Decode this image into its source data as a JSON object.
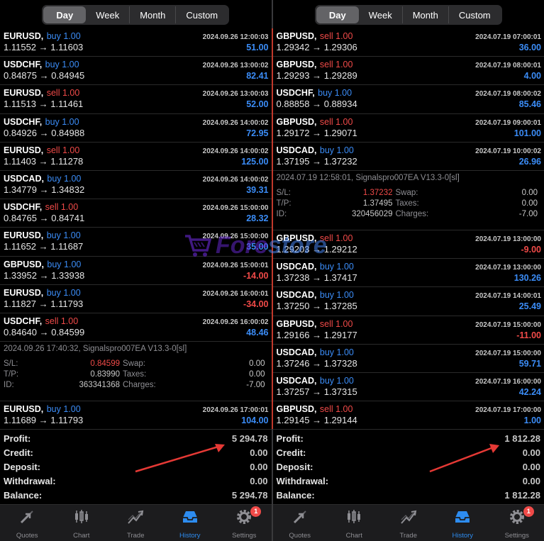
{
  "periods": [
    "Day",
    "Week",
    "Month",
    "Custom"
  ],
  "active_period": "Day",
  "left": {
    "trades": [
      {
        "symbol": "EURUSD,",
        "side": "buy 1.00",
        "dir": "buy",
        "time": "2024.09.26 12:00:03",
        "prices": "1.11552 → 1.11603",
        "profit": "51.00",
        "sign": "pos"
      },
      {
        "symbol": "USDCHF,",
        "side": "buy 1.00",
        "dir": "buy",
        "time": "2024.09.26 13:00:02",
        "prices": "0.84875 → 0.84945",
        "profit": "82.41",
        "sign": "pos"
      },
      {
        "symbol": "EURUSD,",
        "side": "sell 1.00",
        "dir": "sell",
        "time": "2024.09.26 13:00:03",
        "prices": "1.11513 → 1.11461",
        "profit": "52.00",
        "sign": "pos"
      },
      {
        "symbol": "USDCHF,",
        "side": "buy 1.00",
        "dir": "buy",
        "time": "2024.09.26 14:00:02",
        "prices": "0.84926 → 0.84988",
        "profit": "72.95",
        "sign": "pos"
      },
      {
        "symbol": "EURUSD,",
        "side": "sell 1.00",
        "dir": "sell",
        "time": "2024.09.26 14:00:02",
        "prices": "1.11403 → 1.11278",
        "profit": "125.00",
        "sign": "pos"
      },
      {
        "symbol": "USDCAD,",
        "side": "buy 1.00",
        "dir": "buy",
        "time": "2024.09.26 14:00:02",
        "prices": "1.34779 → 1.34832",
        "profit": "39.31",
        "sign": "pos"
      },
      {
        "symbol": "USDCHF,",
        "side": "sell 1.00",
        "dir": "sell",
        "time": "2024.09.26 15:00:00",
        "prices": "0.84765 → 0.84741",
        "profit": "28.32",
        "sign": "pos"
      },
      {
        "symbol": "EURUSD,",
        "side": "buy 1.00",
        "dir": "buy",
        "time": "2024.09.26 15:00:00",
        "prices": "1.11652 → 1.11687",
        "profit": "35.00",
        "sign": "pos"
      },
      {
        "symbol": "GBPUSD,",
        "side": "buy 1.00",
        "dir": "buy",
        "time": "2024.09.26 15:00:01",
        "prices": "1.33952 → 1.33938",
        "profit": "-14.00",
        "sign": "neg"
      },
      {
        "symbol": "EURUSD,",
        "side": "buy 1.00",
        "dir": "buy",
        "time": "2024.09.26 16:00:01",
        "prices": "1.11827 → 1.11793",
        "profit": "-34.00",
        "sign": "neg"
      },
      {
        "symbol": "USDCHF,",
        "side": "sell 1.00",
        "dir": "sell",
        "time": "2024.09.26 16:00:02",
        "prices": "0.84640 → 0.84599",
        "profit": "48.46",
        "sign": "pos"
      }
    ],
    "detail": {
      "header": "2024.09.26 17:40:32, Signalspro007EA V13.3-0[sl]",
      "sl_label": "S/L:",
      "sl": "0.84599",
      "swap_label": "Swap:",
      "swap": "0.00",
      "tp_label": "T/P:",
      "tp": "0.83990",
      "taxes_label": "Taxes:",
      "taxes": "0.00",
      "id_label": "ID:",
      "id": "363341368",
      "charges_label": "Charges:",
      "charges": "-7.00"
    },
    "last_trade": {
      "symbol": "EURUSD,",
      "side": "buy 1.00",
      "dir": "buy",
      "time": "2024.09.26 17:00:01",
      "prices": "1.11689 → 1.11793",
      "profit": "104.00",
      "sign": "pos"
    },
    "summary": [
      {
        "label": "Profit:",
        "value": "5 294.78"
      },
      {
        "label": "Credit:",
        "value": "0.00"
      },
      {
        "label": "Deposit:",
        "value": "0.00"
      },
      {
        "label": "Withdrawal:",
        "value": "0.00"
      },
      {
        "label": "Balance:",
        "value": "5 294.78"
      }
    ]
  },
  "right": {
    "trades": [
      {
        "symbol": "GBPUSD,",
        "side": "sell 1.00",
        "dir": "sell",
        "time": "2024.07.19 07:00:01",
        "prices": "1.29342 → 1.29306",
        "profit": "36.00",
        "sign": "pos"
      },
      {
        "symbol": "GBPUSD,",
        "side": "sell 1.00",
        "dir": "sell",
        "time": "2024.07.19 08:00:01",
        "prices": "1.29293 → 1.29289",
        "profit": "4.00",
        "sign": "pos"
      },
      {
        "symbol": "USDCHF,",
        "side": "buy 1.00",
        "dir": "buy",
        "time": "2024.07.19 08:00:02",
        "prices": "0.88858 → 0.88934",
        "profit": "85.46",
        "sign": "pos"
      },
      {
        "symbol": "GBPUSD,",
        "side": "sell 1.00",
        "dir": "sell",
        "time": "2024.07.19 09:00:01",
        "prices": "1.29172 → 1.29071",
        "profit": "101.00",
        "sign": "pos"
      },
      {
        "symbol": "USDCAD,",
        "side": "buy 1.00",
        "dir": "buy",
        "time": "2024.07.19 10:00:02",
        "prices": "1.37195 → 1.37232",
        "profit": "26.96",
        "sign": "pos"
      }
    ],
    "detail": {
      "header": "2024.07.19 12:58:01, Signalspro007EA V13.3-0[sl]",
      "sl_label": "S/L:",
      "sl": "1.37232",
      "swap_label": "Swap:",
      "swap": "0.00",
      "tp_label": "T/P:",
      "tp": "1.37495",
      "taxes_label": "Taxes:",
      "taxes": "0.00",
      "id_label": "ID:",
      "id": "320456029",
      "charges_label": "Charges:",
      "charges": "-7.00"
    },
    "trades2": [
      {
        "symbol": "GBPUSD,",
        "side": "sell 1.00",
        "dir": "sell",
        "time": "2024.07.19 13:00:00",
        "prices": "1.29203 → 1.29212",
        "profit": "-9.00",
        "sign": "neg"
      },
      {
        "symbol": "USDCAD,",
        "side": "buy 1.00",
        "dir": "buy",
        "time": "2024.07.19 13:00:00",
        "prices": "1.37238 → 1.37417",
        "profit": "130.26",
        "sign": "pos"
      },
      {
        "symbol": "USDCAD,",
        "side": "buy 1.00",
        "dir": "buy",
        "time": "2024.07.19 14:00:01",
        "prices": "1.37250 → 1.37285",
        "profit": "25.49",
        "sign": "pos"
      },
      {
        "symbol": "GBPUSD,",
        "side": "sell 1.00",
        "dir": "sell",
        "time": "2024.07.19 15:00:00",
        "prices": "1.29166 → 1.29177",
        "profit": "-11.00",
        "sign": "neg"
      },
      {
        "symbol": "USDCAD,",
        "side": "buy 1.00",
        "dir": "buy",
        "time": "2024.07.19 15:00:00",
        "prices": "1.37246 → 1.37328",
        "profit": "59.71",
        "sign": "pos"
      },
      {
        "symbol": "USDCAD,",
        "side": "buy 1.00",
        "dir": "buy",
        "time": "2024.07.19 16:00:00",
        "prices": "1.37257 → 1.37315",
        "profit": "42.24",
        "sign": "pos"
      },
      {
        "symbol": "GBPUSD,",
        "side": "sell 1.00",
        "dir": "sell",
        "time": "2024.07.19 17:00:00",
        "prices": "1.29145 → 1.29144",
        "profit": "1.00",
        "sign": "pos"
      }
    ],
    "summary": [
      {
        "label": "Profit:",
        "value": "1 812.28"
      },
      {
        "label": "Credit:",
        "value": "0.00"
      },
      {
        "label": "Deposit:",
        "value": "0.00"
      },
      {
        "label": "Withdrawal:",
        "value": "0.00"
      },
      {
        "label": "Balance:",
        "value": "1 812.28"
      }
    ]
  },
  "tabs": [
    {
      "label": "Quotes",
      "icon": "quotes-icon"
    },
    {
      "label": "Chart",
      "icon": "chart-icon"
    },
    {
      "label": "Trade",
      "icon": "trade-icon"
    },
    {
      "label": "History",
      "icon": "history-icon",
      "active": true
    },
    {
      "label": "Settings",
      "icon": "settings-icon",
      "badge": "1"
    }
  ],
  "watermark": {
    "text_a": "Fore",
    "text_b": "store"
  },
  "colors": {
    "buy": "#3b8cf6",
    "sell": "#f04a48",
    "active_tab": "#2d8cf0",
    "annotation_arrow": "#e53935"
  }
}
